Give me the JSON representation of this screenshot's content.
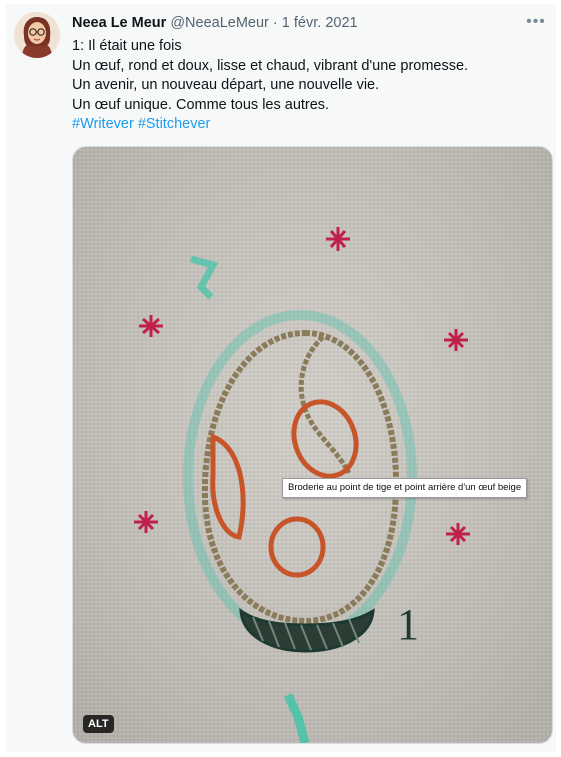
{
  "tweet": {
    "author_name": "Neea Le Meur",
    "author_handle": "@NeeaLeMeur",
    "separator": "·",
    "date": "1 févr. 2021",
    "more_label": "•••",
    "lines": [
      "1: Il était une fois",
      "Un œuf, rond et doux, lisse et chaud, vibrant d'une promesse.",
      "Un avenir, un nouveau départ, une nouvelle vie.",
      "Un œuf unique. Comme tous les autres."
    ],
    "hashtags": [
      "#Writever",
      "#Stitchever"
    ],
    "media": {
      "alt_badge": "ALT",
      "tooltip": "Broderie au point de tige et point arrière d'un œuf beige",
      "stitched_number": "1"
    }
  },
  "colors": {
    "link": "#1d9bf0",
    "fabric": "#c9c5bf",
    "egg_outline": "#8a7b5a",
    "spots": "#c8552a",
    "stars": "#c0204a",
    "teal": "#3cc4a8",
    "base": "#1e3a30"
  }
}
